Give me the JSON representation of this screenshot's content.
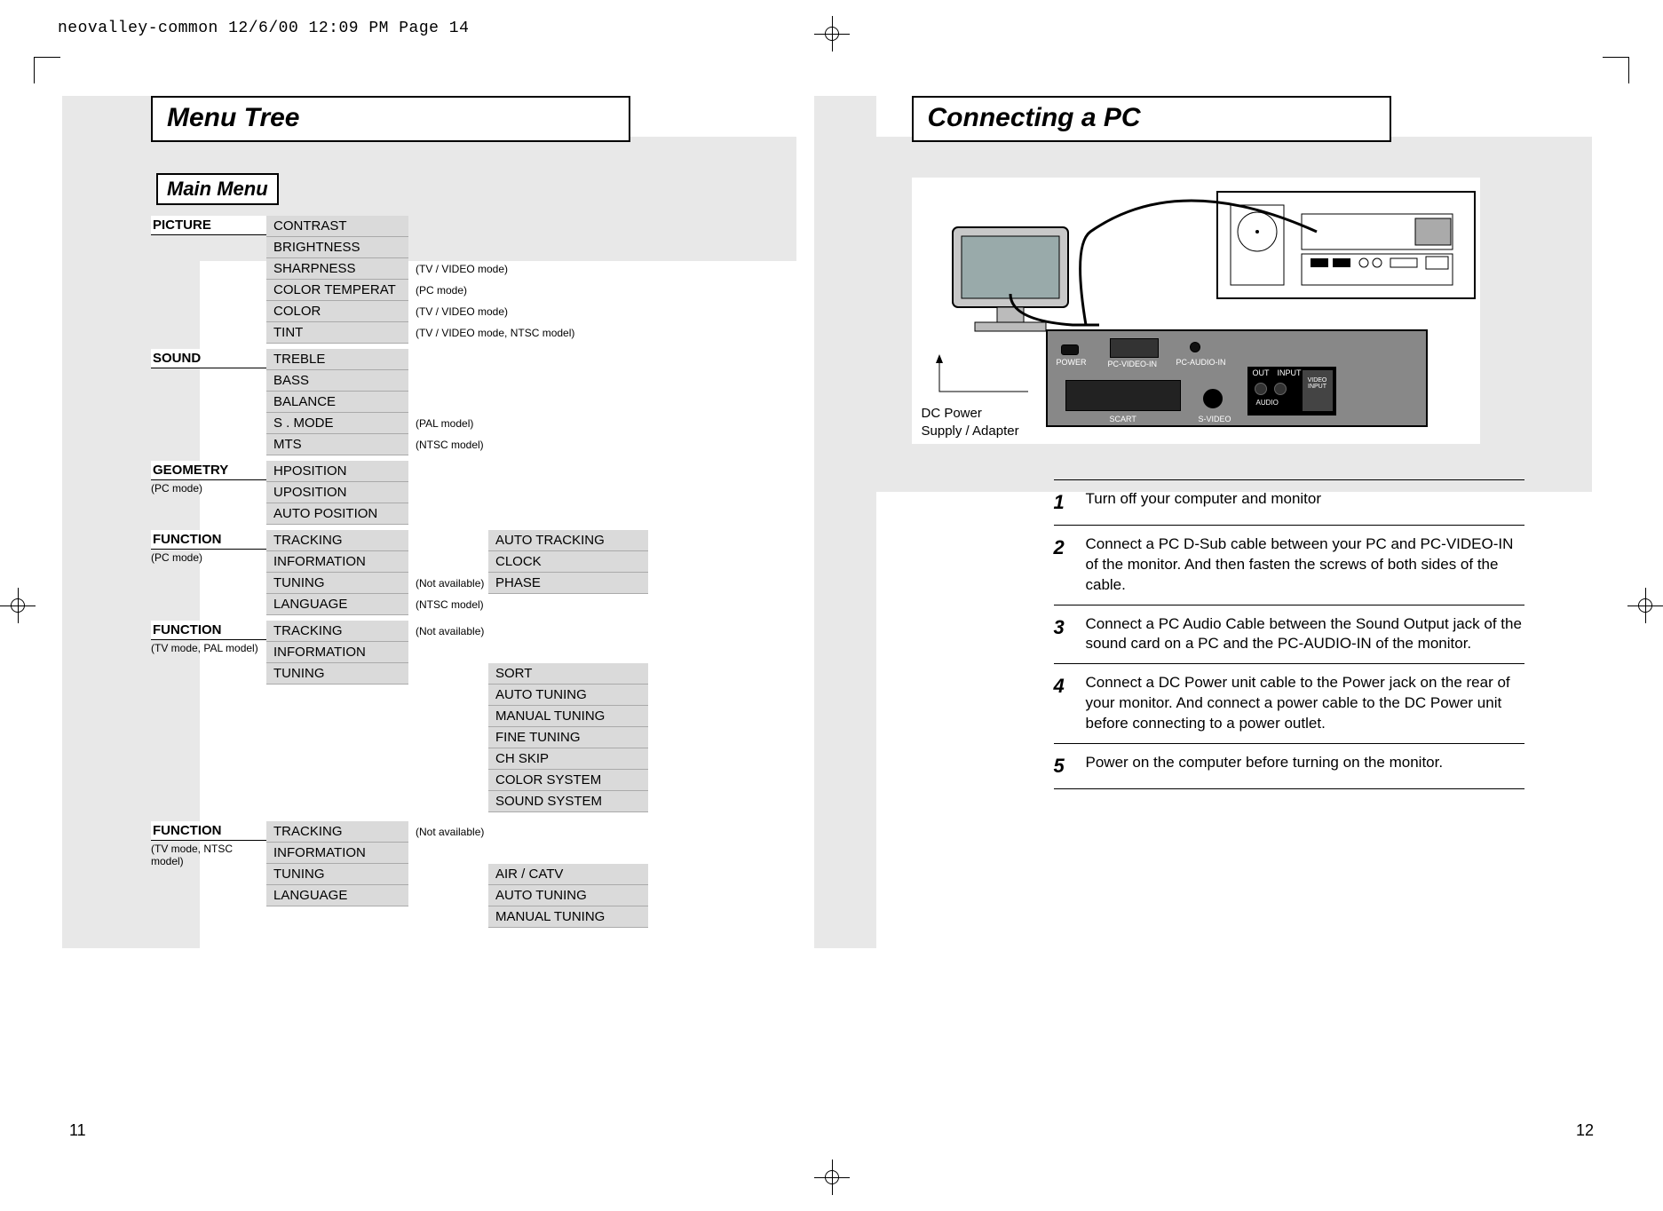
{
  "print_header": "neovalley-common  12/6/00  12:09 PM  Page 14",
  "left": {
    "title": "Menu Tree",
    "main_menu_label": "Main Menu",
    "page_number": "11",
    "sections": [
      {
        "root": "PICTURE",
        "root_note": "",
        "items": [
          {
            "label": "CONTRAST",
            "note": ""
          },
          {
            "label": "BRIGHTNESS",
            "note": ""
          },
          {
            "label": "SHARPNESS",
            "note": "(TV / VIDEO mode)"
          },
          {
            "label": "COLOR TEMPERAT",
            "note": "(PC mode)"
          },
          {
            "label": "COLOR",
            "note": "(TV / VIDEO mode)"
          },
          {
            "label": "TINT",
            "note": "(TV / VIDEO mode, NTSC model)"
          }
        ]
      },
      {
        "root": "SOUND",
        "root_note": "",
        "items": [
          {
            "label": "TREBLE",
            "note": ""
          },
          {
            "label": "BASS",
            "note": ""
          },
          {
            "label": "BALANCE",
            "note": ""
          },
          {
            "label": "S . MODE",
            "note": "(PAL model)"
          },
          {
            "label": "MTS",
            "note": "(NTSC model)"
          }
        ]
      },
      {
        "root": "GEOMETRY",
        "root_note": "(PC mode)",
        "items": [
          {
            "label": "HPOSITION",
            "note": ""
          },
          {
            "label": "UPOSITION",
            "note": ""
          },
          {
            "label": "AUTO POSITION",
            "note": ""
          }
        ]
      },
      {
        "root": "FUNCTION",
        "root_note": "(PC mode)",
        "items": [
          {
            "label": "TRACKING",
            "note": "",
            "sub": [
              "AUTO TRACKING",
              "CLOCK",
              "PHASE"
            ]
          },
          {
            "label": "INFORMATION",
            "note": ""
          },
          {
            "label": "TUNING",
            "note": "(Not available)"
          },
          {
            "label": "LANGUAGE",
            "note": "(NTSC model)"
          }
        ]
      },
      {
        "root": "FUNCTION",
        "root_note": "(TV mode, PAL model)",
        "items": [
          {
            "label": "TRACKING",
            "note": "(Not available)"
          },
          {
            "label": "INFORMATION",
            "note": ""
          },
          {
            "label": "TUNING",
            "note": "",
            "sub": [
              "SORT",
              "AUTO TUNING",
              "MANUAL TUNING",
              "FINE TUNING",
              "CH SKIP",
              "COLOR SYSTEM",
              "SOUND SYSTEM"
            ]
          }
        ]
      },
      {
        "root": "FUNCTION",
        "root_note": "(TV mode, NTSC model)",
        "items": [
          {
            "label": "TRACKING",
            "note": "(Not available)"
          },
          {
            "label": "INFORMATION",
            "note": ""
          },
          {
            "label": "TUNING",
            "note": "",
            "sub": [
              "AIR / CATV",
              "AUTO TUNING",
              "MANUAL TUNING"
            ]
          },
          {
            "label": "LANGUAGE",
            "note": ""
          }
        ]
      }
    ]
  },
  "right": {
    "title": "Connecting a PC",
    "page_number": "12",
    "dc_label_l1": "DC Power",
    "dc_label_l2": "Supply / Adapter",
    "panel_labels": {
      "power": "POWER",
      "pcvideo": "PC-VIDEO-IN",
      "pcaudio": "PC-AUDIO-IN",
      "scart": "SCART",
      "svideo": "S-VIDEO",
      "out": "OUT",
      "input": "INPUT",
      "audio": "AUDIO",
      "videoinput": "VIDEO INPUT"
    },
    "steps": [
      {
        "n": "1",
        "t": "Turn off your computer and monitor"
      },
      {
        "n": "2",
        "t": "Connect a PC D-Sub cable between your PC and PC-VIDEO-IN of the monitor. And then fasten the screws of both sides of the cable."
      },
      {
        "n": "3",
        "t": "Connect a PC Audio Cable between the  Sound Output jack of the sound card on a PC and the PC-AUDIO-IN of the monitor."
      },
      {
        "n": "4",
        "t": "Connect a DC Power unit cable to the Power jack on the rear of your monitor. And connect a power cable to the DC Power unit before   connecting to a power outlet."
      },
      {
        "n": "5",
        "t": "Power on the computer before turning on the monitor."
      }
    ]
  }
}
